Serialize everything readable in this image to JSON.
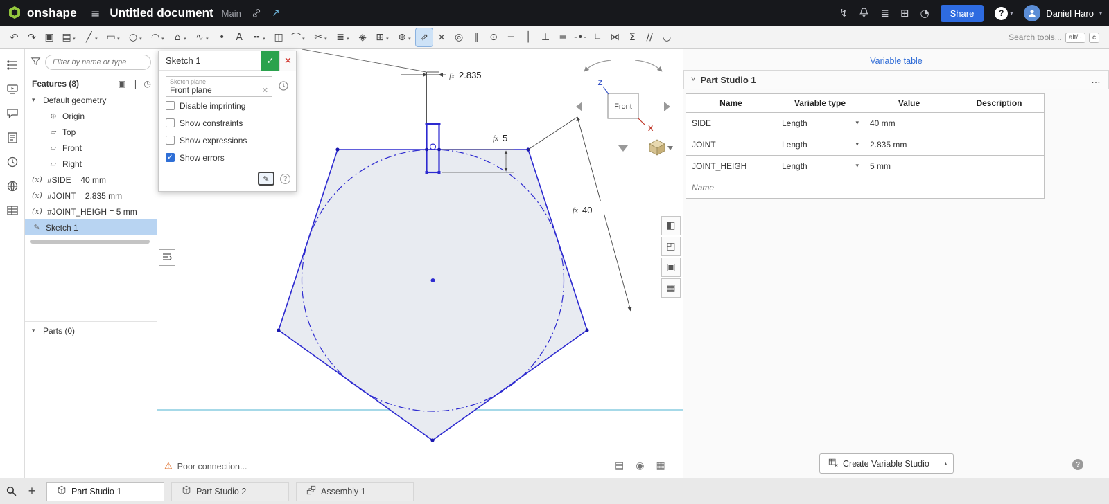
{
  "topbar": {
    "logo_text": "onshape",
    "document_title": "Untitled document",
    "workspace_label": "Main",
    "share_label": "Share",
    "user_name": "Daniel Haro"
  },
  "toolbar": {
    "undo_glyph": "↶",
    "redo_glyph": "↷",
    "icons": [
      {
        "name": "copy-tool",
        "glyph": "▣",
        "caret": false
      },
      {
        "name": "insert-image-tool",
        "glyph": "▤",
        "caret": true
      },
      {
        "name": "line-tool",
        "glyph": "╱",
        "caret": true
      },
      {
        "name": "rectangle-tool",
        "glyph": "▭",
        "caret": true
      },
      {
        "name": "circle-tool",
        "glyph": "○",
        "caret": true
      },
      {
        "name": "arc-tool",
        "glyph": "◠",
        "caret": true
      },
      {
        "name": "polygon-tool",
        "glyph": "⌂",
        "caret": true
      },
      {
        "name": "spline-tool",
        "glyph": "∿",
        "caret": true
      },
      {
        "name": "point-tool",
        "glyph": "•",
        "caret": false
      },
      {
        "name": "text-tool",
        "glyph": "A",
        "caret": false
      },
      {
        "name": "construction-tool",
        "glyph": "╍",
        "caret": true
      },
      {
        "name": "mirror-tool",
        "glyph": "◫",
        "caret": false
      },
      {
        "name": "fillet-tool",
        "glyph": "⌒",
        "caret": true
      },
      {
        "name": "trim-tool",
        "glyph": "✂",
        "caret": true
      },
      {
        "name": "offset-tool",
        "glyph": "≣",
        "caret": true
      },
      {
        "name": "measure-tool",
        "glyph": "◈",
        "caret": false
      },
      {
        "name": "linear-pattern-tool",
        "glyph": "⊞",
        "caret": true
      },
      {
        "name": "circular-pattern-tool",
        "glyph": "⊛",
        "caret": true
      },
      {
        "name": "dimension-tool",
        "glyph": "⇗",
        "caret": false,
        "active": true
      },
      {
        "name": "coincident-constraint",
        "glyph": "×",
        "caret": false
      },
      {
        "name": "concentric-constraint",
        "glyph": "◎",
        "caret": false
      },
      {
        "name": "parallel-constraint",
        "glyph": "∥",
        "caret": false
      },
      {
        "name": "tangent-constraint",
        "glyph": "⊙",
        "caret": false
      },
      {
        "name": "horizontal-constraint",
        "glyph": "─",
        "caret": false
      },
      {
        "name": "vertical-constraint",
        "glyph": "│",
        "caret": false
      },
      {
        "name": "perpendicular-constraint",
        "glyph": "⊥",
        "caret": false
      },
      {
        "name": "equal-constraint",
        "glyph": "=",
        "caret": false
      },
      {
        "name": "midpoint-constraint",
        "glyph": "-•-",
        "caret": false
      },
      {
        "name": "normal-constraint",
        "glyph": "∟",
        "caret": false
      },
      {
        "name": "symmetric-constraint",
        "glyph": "⋈",
        "caret": false
      },
      {
        "name": "pierce-constraint",
        "glyph": "Σ",
        "caret": false
      },
      {
        "name": "hatch-constraint",
        "glyph": "//",
        "caret": false
      },
      {
        "name": "curvature-constraint",
        "glyph": "◡",
        "caret": false
      }
    ],
    "search_placeholder": "Search tools...",
    "shortcut_key_1": "alt/~",
    "shortcut_key_2": "c"
  },
  "left_panel": {
    "filter_placeholder": "Filter by name or type",
    "features_label": "Features (8)",
    "tree": {
      "group_label": "Default geometry",
      "planes": [
        "Origin",
        "Top",
        "Front",
        "Right"
      ]
    },
    "variable_prefix": "(x)",
    "variables": [
      "#SIDE = 40 mm",
      "#JOINT = 2.835 mm",
      "#JOINT_HEIGH = 5 mm"
    ],
    "sketch_label": "Sketch 1",
    "parts_label": "Parts (0)"
  },
  "sketch_dialog": {
    "title": "Sketch 1",
    "plane_field_label": "Sketch plane",
    "plane_field_value": "Front plane",
    "checkboxes": [
      {
        "label": "Disable imprinting",
        "checked": false
      },
      {
        "label": "Show constraints",
        "checked": false
      },
      {
        "label": "Show expressions",
        "checked": false
      },
      {
        "label": "Show errors",
        "checked": true
      }
    ]
  },
  "canvas": {
    "dimensions": {
      "joint_width": {
        "prefix": "fx",
        "value": "2.835"
      },
      "joint_height": {
        "prefix": "fx",
        "value": "5"
      },
      "side": {
        "prefix": "fx",
        "value": "40"
      }
    },
    "view_cube": {
      "face_label": "Front",
      "axis_z": "Z",
      "axis_x": "X"
    },
    "status_message": "Poor connection...",
    "colors": {
      "sketch_blue": "#2d2ad0",
      "accent_blue": "#2e6be0"
    }
  },
  "variable_table": {
    "panel_title": "Variable table",
    "section_label": "Part Studio 1",
    "columns": [
      "Name",
      "Variable type",
      "Value",
      "Description"
    ],
    "rows": [
      {
        "name": "SIDE",
        "type": "Length",
        "value": "40 mm",
        "description": ""
      },
      {
        "name": "JOINT",
        "type": "Length",
        "value": "2.835 mm",
        "description": ""
      },
      {
        "name": "JOINT_HEIGH",
        "type": "Length",
        "value": "5 mm",
        "description": ""
      }
    ],
    "new_row_placeholder": "Name",
    "create_button_label": "Create Variable Studio"
  },
  "bottom_bar": {
    "tabs": [
      {
        "label": "Part Studio 1",
        "active": true,
        "type": "partstudio"
      },
      {
        "label": "Part Studio 2",
        "active": false,
        "type": "partstudio"
      },
      {
        "label": "Assembly 1",
        "active": false,
        "type": "assembly"
      }
    ]
  }
}
